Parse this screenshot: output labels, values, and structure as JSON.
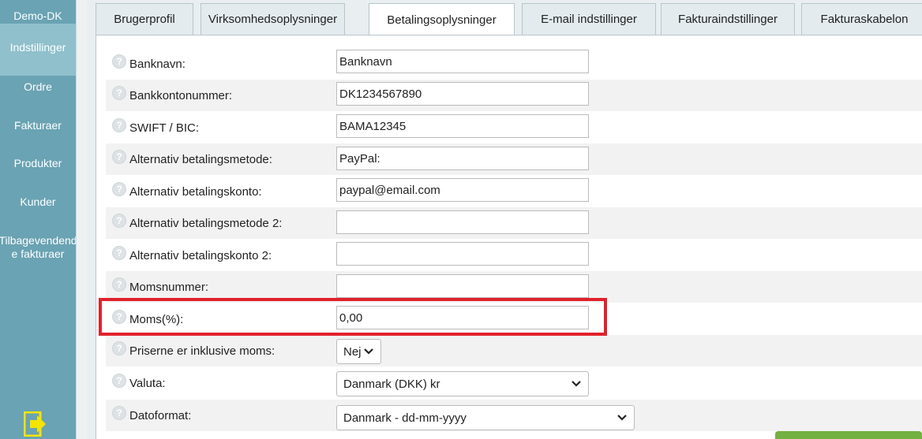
{
  "sidebar": {
    "company": "Demo-DK",
    "items": [
      {
        "label": "Indstillinger",
        "active": true
      },
      {
        "label": "Ordre"
      },
      {
        "label": "Fakturaer"
      },
      {
        "label": "Produkter"
      },
      {
        "label": "Kunder"
      },
      {
        "label": "Tilbagevendende fakturaer"
      }
    ],
    "logout_icon": "logout-icon"
  },
  "tabs": [
    {
      "label": "Brugerprofil"
    },
    {
      "label": "Virksomhedsoplysninger"
    },
    {
      "label": "Betalingsoplysninger",
      "active": true
    },
    {
      "label": "E-mail indstillinger"
    },
    {
      "label": "Fakturaindstillinger"
    },
    {
      "label": "Fakturaskabelon"
    }
  ],
  "form": {
    "bank_name": {
      "label": "Banknavn:",
      "value": "Banknavn"
    },
    "account": {
      "label": "Bankkontonummer:",
      "value": "DK1234567890"
    },
    "swift": {
      "label": "SWIFT / BIC:",
      "value": "BAMA12345"
    },
    "alt_method": {
      "label": "Alternativ betalingsmetode:",
      "value": "PayPal:"
    },
    "alt_account": {
      "label": "Alternativ betalingskonto:",
      "value": "paypal@email.com"
    },
    "alt_method2": {
      "label": "Alternativ betalingsmetode 2:",
      "value": ""
    },
    "alt_account2": {
      "label": "Alternativ betalingskonto 2:",
      "value": ""
    },
    "vat_number": {
      "label": "Momsnummer:",
      "value": ""
    },
    "vat_percent": {
      "label": "Moms(%):",
      "value": "0,00"
    },
    "prices_incl_vat": {
      "label": "Priserne er inklusive moms:",
      "value": "Nej"
    },
    "currency": {
      "label": "Valuta:",
      "value": "Danmark (DKK) kr"
    },
    "date_format": {
      "label": "Datoformat:",
      "value": "Danmark - dd-mm-yyyy"
    }
  },
  "help_glyph": "?",
  "colors": {
    "sidebar": "#6aa3b3",
    "sidebar_active": "#8fc0cc",
    "highlight": "#e0222c",
    "accent_green": "#72b142"
  }
}
